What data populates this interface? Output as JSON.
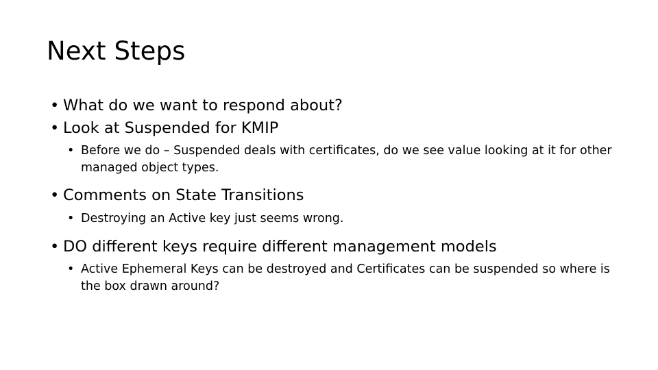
{
  "slide": {
    "title": "Next Steps",
    "bullet_glyph": "•",
    "text_color": "#000000",
    "background_color": "#ffffff",
    "groups": [
      {
        "level1": "What do we want to respond about?",
        "level2": []
      },
      {
        "level1": "Look at Suspended for KMIP",
        "level2": [
          "Before we do – Suspended deals with certificates, do we see value looking at it for other managed object types."
        ]
      },
      {
        "level1": "Comments on State Transitions",
        "level2": [
          "Destroying an Active key just seems wrong."
        ]
      },
      {
        "level1": "DO different keys require different management models",
        "level2": [
          "Active Ephemeral Keys can be destroyed and Certificates can be suspended so where is the box drawn around?"
        ]
      }
    ]
  }
}
